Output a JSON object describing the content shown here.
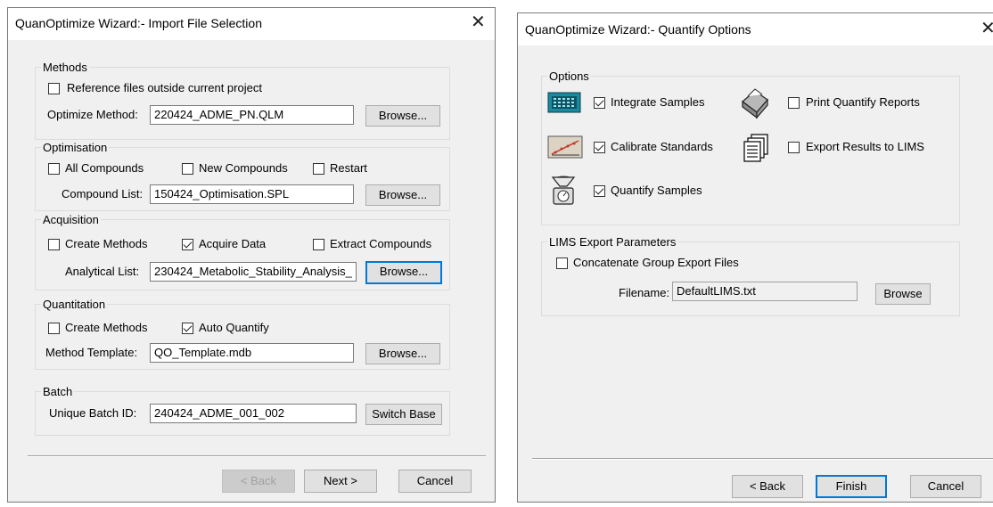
{
  "left": {
    "title": "QuanOptimize Wizard:- Import File Selection",
    "close_icon": "close-icon",
    "methods": {
      "label": "Methods",
      "reference_files": {
        "label": "Reference files outside current project",
        "checked": false
      },
      "optimize_method_label": "Optimize Method:",
      "optimize_method_value": "220424_ADME_PN.QLM",
      "browse": "Browse..."
    },
    "optimisation": {
      "label": "Optimisation",
      "all_compounds": {
        "label": "All Compounds",
        "checked": false
      },
      "new_compounds": {
        "label": "New Compounds",
        "checked": false
      },
      "restart": {
        "label": "Restart",
        "checked": false
      },
      "compound_list_label": "Compound List:",
      "compound_list_value": "150424_Optimisation.SPL",
      "browse": "Browse..."
    },
    "acquisition": {
      "label": "Acquisition",
      "create_methods": {
        "label": "Create Methods",
        "checked": false
      },
      "acquire_data": {
        "label": "Acquire Data",
        "checked": true
      },
      "extract_compounds": {
        "label": "Extract Compounds",
        "checked": false
      },
      "analytical_list_label": "Analytical List:",
      "analytical_list_value": "230424_Metabolic_Stability_Analysis_",
      "browse": "Browse..."
    },
    "quantitation": {
      "label": "Quantitation",
      "create_methods": {
        "label": "Create Methods",
        "checked": false
      },
      "auto_quantify": {
        "label": "Auto Quantify",
        "checked": true
      },
      "method_template_label": "Method Template:",
      "method_template_value": "QO_Template.mdb",
      "browse": "Browse..."
    },
    "batch": {
      "label": "Batch",
      "unique_batch_label": "Unique Batch ID:",
      "unique_batch_value": "240424_ADME_001_002",
      "switch_base": "Switch Base"
    },
    "buttons": {
      "back": "< Back",
      "next": "Next >",
      "cancel": "Cancel"
    }
  },
  "right": {
    "title": "QuanOptimize Wizard:- Quantify Options",
    "options": {
      "label": "Options",
      "integrate_samples": {
        "label": "Integrate Samples",
        "checked": true,
        "icon": "integrate-icon"
      },
      "calibrate_standards": {
        "label": "Calibrate Standards",
        "checked": true,
        "icon": "calibration-chart-icon"
      },
      "quantify_samples": {
        "label": "Quantify Samples",
        "checked": true,
        "icon": "scale-icon"
      },
      "print_reports": {
        "label": "Print Quantify Reports",
        "checked": false,
        "icon": "printer-icon"
      },
      "export_lims": {
        "label": "Export Results to LIMS",
        "checked": false,
        "icon": "documents-icon"
      }
    },
    "lims": {
      "label": "LIMS Export Parameters",
      "concatenate": {
        "label": "Concatenate Group Export Files",
        "checked": false
      },
      "filename_label": "Filename:",
      "filename_value": "DefaultLIMS.txt",
      "browse": "Browse"
    },
    "buttons": {
      "back": "< Back",
      "finish": "Finish",
      "cancel": "Cancel"
    }
  }
}
